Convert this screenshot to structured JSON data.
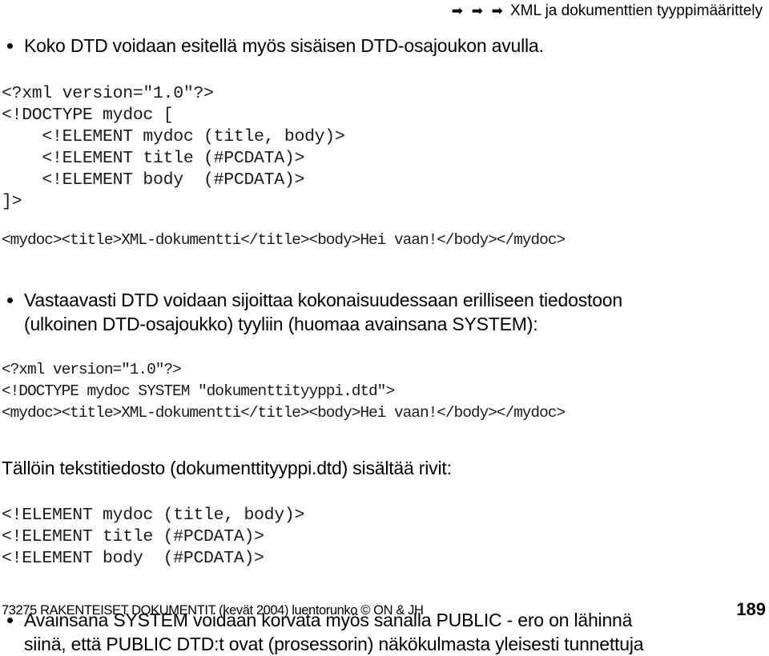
{
  "header": {
    "arrows": "➡ ➡ ➡",
    "title": "XML ja dokumenttien tyyppimäärittely"
  },
  "content": {
    "bullet1": "Koko DTD voidaan esitellä myös sisäisen DTD-osajoukon avulla.",
    "code_block1": "<?xml version=\"1.0\"?>\n<!DOCTYPE mydoc [\n    <!ELEMENT mydoc (title, body)>\n    <!ELEMENT title (#PCDATA)>\n    <!ELEMENT body  (#PCDATA)>\n]>",
    "code_block1_long": "<mydoc><title>XML-dokumentti</title><body>Hei vaan!</body></mydoc>",
    "bullet2_line1": "Vastaavasti DTD voidaan sijoittaa kokonaisuudessaan erilliseen tiedostoon",
    "bullet2_line2": "(ulkoinen DTD-osajoukko) tyyliin (huomaa avainsana SYSTEM):",
    "code_block2": "<?xml version=\"1.0\"?>\n<!DOCTYPE mydoc SYSTEM \"dokumenttityyppi.dtd\">\n<mydoc><title>XML-dokumentti</title><body>Hei vaan!</body></mydoc>",
    "para1": "Tällöin tekstitiedosto (dokumenttityyppi.dtd) sisältää rivit:",
    "code_block3": "<!ELEMENT mydoc (title, body)>\n<!ELEMENT title (#PCDATA)>\n<!ELEMENT body  (#PCDATA)>",
    "bullet3_line1": "Avainsana SYSTEM voidaan korvata myös sanalla PUBLIC - ero on lähinnä",
    "bullet3_line2": "siinä, että PUBLIC DTD:t ovat (prosessorin) näkökulmasta yleisesti tunnettuja"
  },
  "footer": {
    "text": "73275 RAKENTEISET DOKUMENTIT (kevät 2004) luentorunko © ON & JH",
    "page": "189"
  }
}
